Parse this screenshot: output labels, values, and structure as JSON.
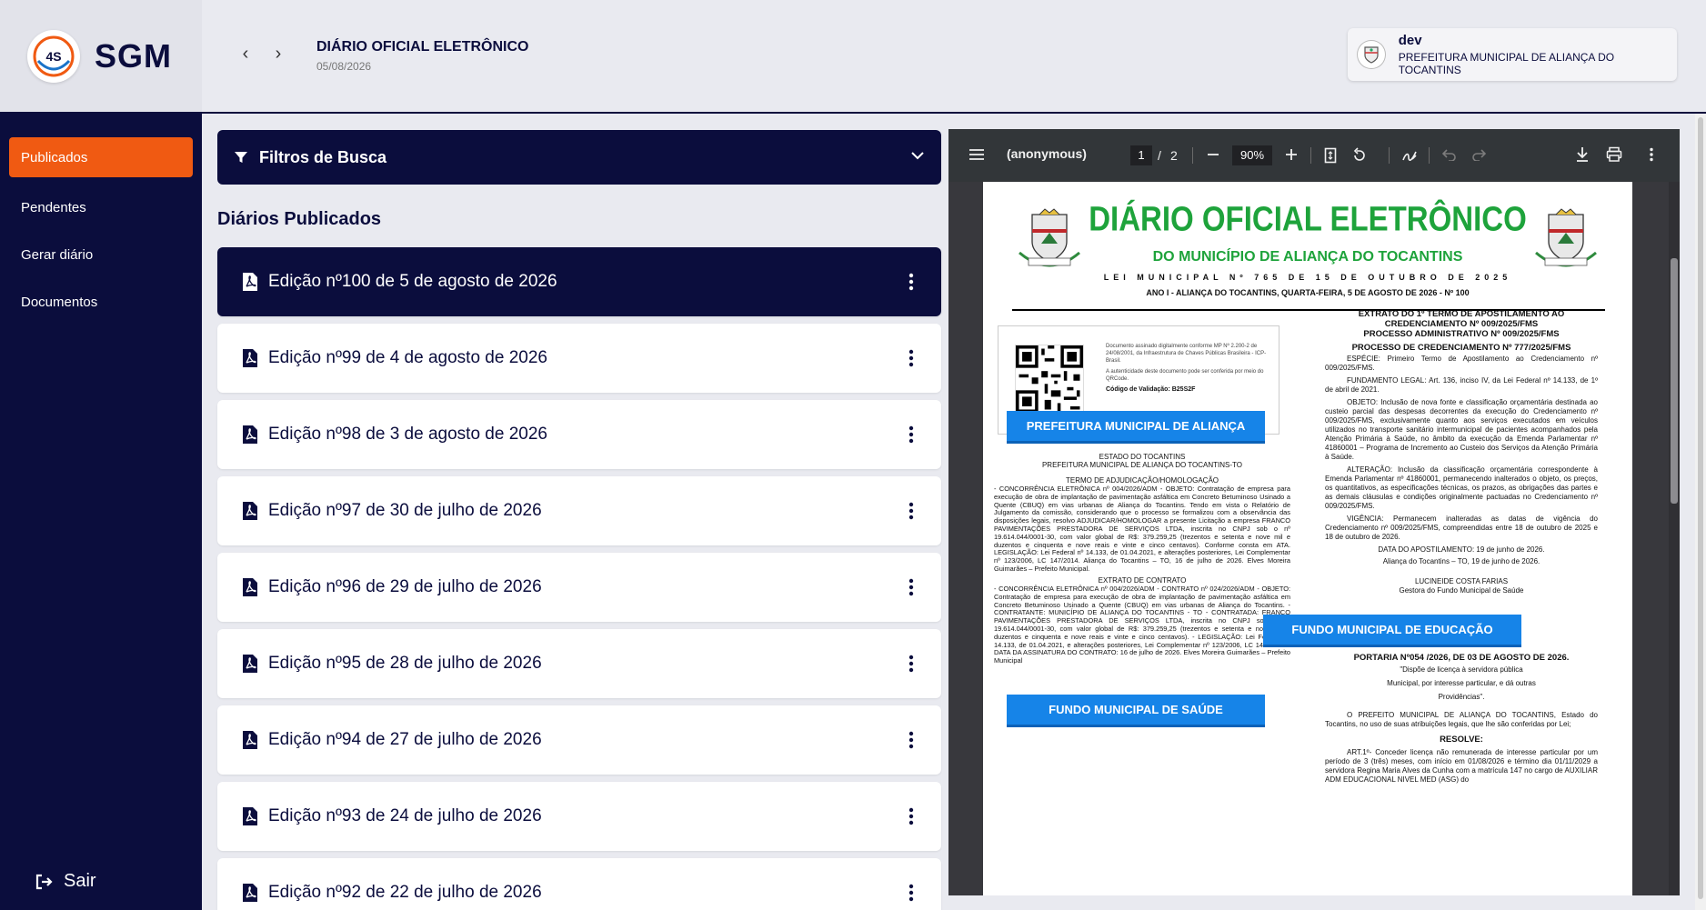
{
  "app": {
    "logo_badge": "4S",
    "logo_text": "SGM"
  },
  "header": {
    "back_icon": "chevron-left-icon",
    "forward_icon": "chevron-right-icon",
    "title": "DIÁRIO OFICIAL ELETRÔNICO",
    "date": "05/08/2026"
  },
  "user": {
    "name": "dev",
    "org": "PREFEITURA MUNICIPAL DE ALIANÇA DO TOCANTINS"
  },
  "sidebar": {
    "items": [
      {
        "label": "Publicados",
        "active": true
      },
      {
        "label": "Pendentes",
        "active": false
      },
      {
        "label": "Gerar diário",
        "active": false
      },
      {
        "label": "Documentos",
        "active": false
      }
    ],
    "logout_label": "Sair"
  },
  "filters": {
    "title": "Filtros de Busca"
  },
  "list": {
    "section_title": "Diários Publicados",
    "editions": [
      {
        "label": "Edição nº100 de 5 de agosto de 2026",
        "active": true
      },
      {
        "label": "Edição nº99 de 4 de agosto de 2026",
        "active": false
      },
      {
        "label": "Edição nº98 de 3 de agosto de 2026",
        "active": false
      },
      {
        "label": "Edição nº97 de 30 de julho de 2026",
        "active": false
      },
      {
        "label": "Edição nº96 de 29 de julho de 2026",
        "active": false
      },
      {
        "label": "Edição nº95 de 28 de julho de 2026",
        "active": false
      },
      {
        "label": "Edição nº94 de 27 de julho de 2026",
        "active": false
      },
      {
        "label": "Edição nº93 de 24 de julho de 2026",
        "active": false
      },
      {
        "label": "Edição nº92 de 22 de julho de 2026",
        "active": false
      }
    ]
  },
  "viewer": {
    "doc_title": "(anonymous)",
    "current_page": "1",
    "page_separator": "/",
    "total_pages": "2",
    "zoom": "90%",
    "colors": {
      "toolbar": "#323639",
      "background": "#38383d"
    }
  },
  "pdf": {
    "title": "DIÁRIO OFICIAL ELETRÔNICO",
    "subtitle": "DO MUNICÍPIO DE ALIANÇA DO TOCANTINS",
    "law": "LEI MUNICIPAL Nº 765 DE 15 DE OUTUBRO DE 2025",
    "edition_line": "ANO I - ALIANÇA DO TOCANTINS, QUARTA-FEIRA, 5 DE AGOSTO DE 2026 - Nº 100",
    "sign_text": "Documento assinado digitalmente conforme MP Nº 2.200-2 de 24/08/2001, da Infraestrutura de Chaves Públicas Brasileira - ICP-Brasil.",
    "auth_text": "A autenticidade deste documento pode ser conferida por meio do QRCode.",
    "validation": "Código de Validação: B25S2F",
    "left": {
      "btn1": "PREFEITURA MUNICIPAL DE ALIANÇA",
      "state": "ESTADO DO TOCANTINS",
      "pref": "PREFEITURA MUNICIPAL DE ALIANÇA DO TOCANTINS-TO",
      "termo_title": "TERMO DE ADJUDICAÇÃO/HOMOLOGAÇÃO",
      "termo_body": "- CONCORRÊNCIA ELETRÔNICA nº 004/2026/ADM - OBJETO: Contratação de empresa para execução de obra de implantação de pavimentação asfáltica em Concreto Betuminoso Usinado a Quente (CBUQ) em vias urbanas de Aliança do Tocantins. Tendo em vista o Relatório de Julgamento da comissão, considerando que o processo se formalizou com a observância das disposições legais, resolvo ADJUDICAR/HOMOLOGAR a presente Licitação a empresa FRANCO PAVIMENTAÇÕES PRESTADORA DE SERVIÇOS LTDA, inscrita no CNPJ sob o nº 19.614.044/0001-30, com valor global de R$: 379.259,25 (trezentos e setenta e nove mil e duzentos e cinquenta e nove reais e vinte e cinco centavos). Conforme consta em ATA. LEGISLAÇÃO: Lei Federal nº 14.133, de 01.04.2021, e alterações posteriores, Lei Complementar nº 123/2006, LC 147/2014. Aliança do Tocantins – TO, 16 de julho de 2026. Elves Moreira Guimarães – Prefeito Municipal.",
      "extrato_title": "EXTRATO DE CONTRATO",
      "extrato_body": "- CONCORRÊNCIA ELETRÔNICA nº 004/2026/ADM - CONTRATO nº 024/2026/ADM - OBJETO: Contratação de empresa para execução de obra de implantação de pavimentação asfáltica em Concreto Betuminoso Usinado a Quente (CBUQ) em vias urbanas de Aliança do Tocantins. - CONTRATANTE: MUNICÍPIO DE ALIANÇA DO TOCANTINS - TO - CONTRATADA: FRANCO PAVIMENTAÇÕES PRESTADORA DE SERVIÇOS LTDA, inscrita no CNPJ sob o nº 19.614.044/0001-30, com valor global de R$: 379.259,25 (trezentos e setenta e nove mil e duzentos e cinquenta e nove reais e vinte e cinco centavos). - LEGISLAÇÃO: Lei Federal nº 14.133, de 01.04.2021, e alterações posteriores, Lei Complementar nº 123/2006, LC 147/2014. - DATA DA ASSINATURA DO CONTRATO: 16 de julho de 2026. Elves Moreira Guimarães – Prefeito Municipal",
      "btn2": "FUNDO MUNICIPAL DE SAÚDE"
    },
    "right": {
      "h1": "EXTRATO DO 1º TERMO DE APOSTILAMENTO AO CREDENCIAMENTO Nº 009/2025/FMS",
      "h2": "PROCESSO ADMINISTRATIVO Nº 009/2025/FMS",
      "h3": "PROCESSO DE CREDENCIAMENTO Nº 777/2025/FMS",
      "p1": "ESPÉCIE: Primeiro Termo de Apostilamento ao Credenciamento nº 009/2025/FMS.",
      "p2": "FUNDAMENTO LEGAL: Art. 136, inciso IV, da Lei Federal nº 14.133, de 1º de abril de 2021.",
      "p3": "OBJETO: Inclusão de nova fonte e classificação orçamentária destinada ao custeio parcial das despesas decorrentes da execução do Credenciamento nº 009/2025/FMS, exclusivamente quanto aos serviços executados em veículos utilizados no transporte sanitário intermunicipal de pacientes acompanhados pela Atenção Primária à Saúde, no âmbito da execução da Emenda Parlamentar nº 41860001 – Programa de Incremento ao Custeio dos Serviços da Atenção Primária à Saúde.",
      "p4": "ALTERAÇÃO: Inclusão da classificação orçamentária correspondente à Emenda Parlamentar nº 41860001, permanecendo inalterados o objeto, os preços, os quantitativos, as especificações técnicas, os prazos, as obrigações das partes e as demais cláusulas e condições originalmente pactuadas no Credenciamento nº 009/2025/FMS.",
      "p5": "VIGÊNCIA: Permanecem inalteradas as datas de vigência do Credenciamento nº 009/2025/FMS, compreendidas entre 18 de outubro de 2025 e 18 de outubro de 2026.",
      "date1": "DATA DO APOSTILAMENTO: 19 de junho de 2026.",
      "date2": "Aliança do Tocantins – TO, 19 de junho de 2026.",
      "signer": "LUCINEIDE COSTA FARIAS",
      "signer_role": "Gestora do Fundo Municipal de Saúde",
      "btn": "FUNDO MUNICIPAL DE EDUCAÇÃO",
      "portaria": "PORTARIA Nº054 /2026, DE 03 DE AGOSTO DE 2026.",
      "ementa1": "\"Dispõe de licença à servidora pública",
      "ementa2": "Municipal, por interesse particular, e dá outras",
      "ementa3": "Providências\".",
      "prefeito": "O PREFEITO MUNICIPAL DE ALIANÇA DO TOCANTINS, Estado do Tocantins, no uso de suas atribuições legais, que lhe são conferidas por Lei;",
      "resolve": "RESOLVE:",
      "art1": "ART.1º- Conceder licença não remunerada de interesse particular por um período de 3 (três) meses, com início em 01/08/2026 e término dia 01/11/2029 a servidora Regina Maria Alves da Cunha com a matrícula 147 no cargo de AUXILIAR ADM EDUCACIONAL NIVEL MED (ASG) do"
    }
  }
}
